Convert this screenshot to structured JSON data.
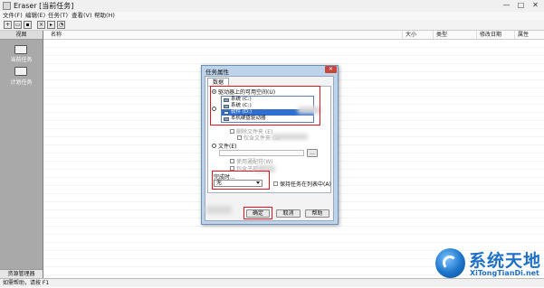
{
  "window": {
    "title": "Eraser [当前任务]",
    "controls": [
      "—",
      "□",
      "✕"
    ]
  },
  "menu": [
    "文件(F)",
    "编辑(E)",
    "任务(T)",
    "查看(V)",
    "帮助(H)"
  ],
  "toolbar": {
    "icons": [
      "new-task-icon",
      "open-icon",
      "save-icon",
      "delete-icon",
      "run-icon",
      "scheduler-icon"
    ]
  },
  "left_pane": {
    "header": "视图",
    "items": [
      {
        "label": "当前任务",
        "icon": "tasks-icon"
      },
      {
        "label": "计划任务",
        "icon": "schedule-icon"
      }
    ],
    "footer": "资源管理器"
  },
  "list": {
    "columns": [
      "名称",
      "大小",
      "类型",
      "修改日期",
      "属性"
    ]
  },
  "status_bar": "如需帮助，请按 F1",
  "dialog": {
    "title": "任务属性",
    "close": "✕",
    "tab": "数据",
    "option_drive": "驱动器上的可用空间(U)",
    "option_files": "文件夹",
    "drive_list": [
      {
        "label": "系统 (C:)",
        "selected": false
      },
      {
        "label": "系统 (C:)",
        "selected": false
      },
      {
        "label": "软件 (D:)",
        "selected": true
      },
      {
        "label": "本机硬盘驱动器",
        "selected": false
      }
    ],
    "opt_delete_folder": "删除文件夹 (E)",
    "opt_subfolder": "仅含文件夹 (S)",
    "option_file": "文件(E)",
    "opt_use_mask": "使用通配符(W)",
    "opt_include": "包含子项 (I)",
    "done_label": "完成时...",
    "done_value": "无",
    "keep_in_list": "保持任务在列表中(A)",
    "buttons": {
      "ok": "确定",
      "cancel": "取消",
      "help": "帮助"
    }
  },
  "watermark": {
    "main": "系统天地",
    "sub": "XiTongTianDi.net"
  },
  "colors": {
    "highlight_red": "#e0161d",
    "selection_blue": "#2f6fd1",
    "watermark_blue": "#1e6fc6"
  }
}
